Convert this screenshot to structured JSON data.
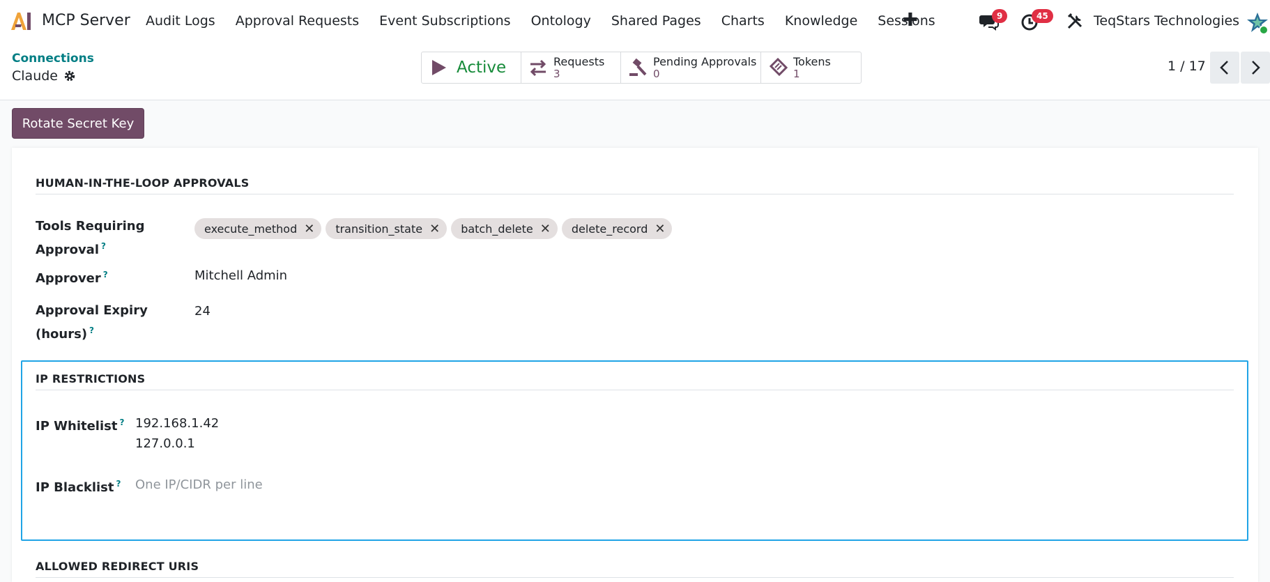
{
  "navbar": {
    "app_name": "MCP Server",
    "menu": [
      "Audit Logs",
      "Approval Requests",
      "Event Subscriptions",
      "Ontology",
      "Shared Pages",
      "Charts",
      "Knowledge",
      "Sessions"
    ],
    "messages_count": "9",
    "activities_count": "45",
    "company": "TeqStars Technologies"
  },
  "breadcrumb": {
    "parent": "Connections",
    "current": "Claude"
  },
  "smart_buttons": {
    "status": "Active",
    "requests_label": "Requests",
    "requests_value": "3",
    "pending_label": "Pending Approvals",
    "pending_value": "0",
    "tokens_label": "Tokens",
    "tokens_value": "1"
  },
  "pager": {
    "value": "1 / 17"
  },
  "header_buttons": {
    "rotate": "Rotate Secret Key"
  },
  "approvals": {
    "title": "HUMAN-IN-THE-LOOP APPROVALS",
    "tools_label_1": "Tools Requiring",
    "tools_label_2": "Approval",
    "tools": [
      "execute_method",
      "transition_state",
      "batch_delete",
      "delete_record"
    ],
    "approver_label": "Approver",
    "approver_value": "Mitchell Admin",
    "expiry_label_1": "Approval Expiry",
    "expiry_label_2": "(hours)",
    "expiry_value": "24"
  },
  "ip": {
    "title": "IP RESTRICTIONS",
    "whitelist_label": "IP Whitelist",
    "whitelist_line_1": "192.168.1.42",
    "whitelist_line_2": "127.0.0.1",
    "blacklist_label": "IP Blacklist",
    "blacklist_placeholder": "One IP/CIDR per line"
  },
  "redirect": {
    "title": "ALLOWED REDIRECT URIS"
  },
  "help_mark": "?",
  "colors": {
    "brand": "#714b67",
    "link": "#017e84",
    "success": "#178b3a",
    "badge": "#e02f44",
    "focus": "#20a4e6"
  }
}
